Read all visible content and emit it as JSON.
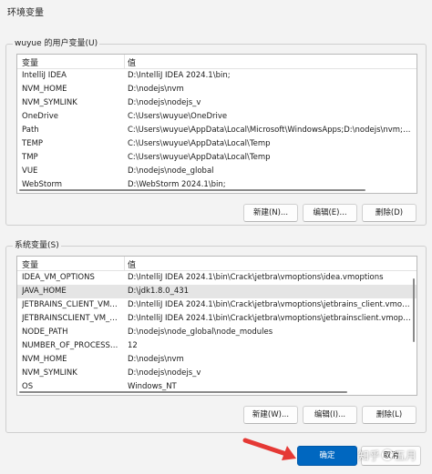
{
  "window": {
    "title": "环境变量"
  },
  "user_vars": {
    "label": "wuyue 的用户变量(U)",
    "columns": [
      "变量",
      "值"
    ],
    "rows": [
      {
        "name": "IntelliJ IDEA",
        "value": "D:\\IntelliJ IDEA 2024.1\\bin;"
      },
      {
        "name": "NVM_HOME",
        "value": "D:\\nodejs\\nvm"
      },
      {
        "name": "NVM_SYMLINK",
        "value": "D:\\nodejs\\nodejs_v"
      },
      {
        "name": "OneDrive",
        "value": "C:\\Users\\wuyue\\OneDrive"
      },
      {
        "name": "Path",
        "value": "C:\\Users\\wuyue\\AppData\\Local\\Microsoft\\WindowsApps;D:\\nodejs\\nvm;D:\\nodejs\\nodejs_v;D:..."
      },
      {
        "name": "TEMP",
        "value": "C:\\Users\\wuyue\\AppData\\Local\\Temp"
      },
      {
        "name": "TMP",
        "value": "C:\\Users\\wuyue\\AppData\\Local\\Temp"
      },
      {
        "name": "VUE",
        "value": "D:\\nodejs\\node_global"
      },
      {
        "name": "WebStorm",
        "value": "D:\\WebStorm 2024.1\\bin;"
      }
    ],
    "buttons": {
      "new": "新建(N)...",
      "edit": "编辑(E)...",
      "delete": "删除(D)"
    }
  },
  "system_vars": {
    "label": "系统变量(S)",
    "columns": [
      "变量",
      "值"
    ],
    "rows": [
      {
        "name": "IDEA_VM_OPTIONS",
        "value": "D:\\IntelliJ IDEA 2024.1\\bin\\Crack\\jetbra\\vmoptions\\idea.vmoptions"
      },
      {
        "name": "JAVA_HOME",
        "value": "D:\\jdk1.8.0_431"
      },
      {
        "name": "JETBRAINS_CLIENT_VM_O...",
        "value": "D:\\IntelliJ IDEA 2024.1\\bin\\Crack\\jetbra\\vmoptions\\jetbrains_client.vmoptions"
      },
      {
        "name": "JETBRAINSCLIENT_VM_O...",
        "value": "D:\\IntelliJ IDEA 2024.1\\bin\\Crack\\jetbra\\vmoptions\\jetbrainsclient.vmoptions"
      },
      {
        "name": "NODE_PATH",
        "value": "D:\\nodejs\\node_global\\node_modules"
      },
      {
        "name": "NUMBER_OF_PROCESSORS",
        "value": "12"
      },
      {
        "name": "NVM_HOME",
        "value": "D:\\nodejs\\nvm"
      },
      {
        "name": "NVM_SYMLINK",
        "value": "D:\\nodejs\\nodejs_v"
      },
      {
        "name": "OS",
        "value": "Windows_NT"
      }
    ],
    "buttons": {
      "new": "新建(W)...",
      "edit": "编辑(I)...",
      "delete": "删除(L)"
    }
  },
  "footer": {
    "ok": "确定",
    "cancel": "取消"
  },
  "watermark": {
    "text_left": "知乎",
    "text_right": "五月"
  },
  "colors": {
    "accent": "#0067c0",
    "arrow": "#e53935",
    "selected_row": "#e5e5e5"
  }
}
